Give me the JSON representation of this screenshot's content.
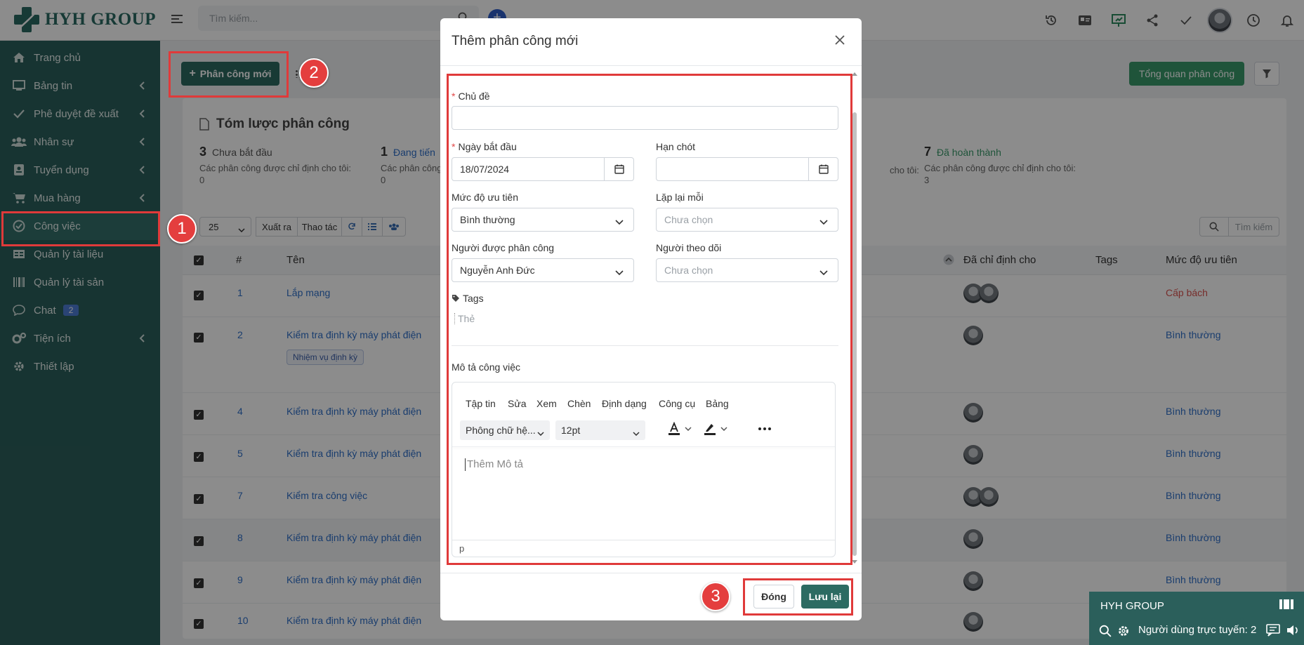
{
  "brand": {
    "name": "HYH GROUP"
  },
  "topbar": {
    "search_placeholder": "Tìm kiếm..."
  },
  "sidebar": {
    "items": [
      {
        "label": "Trang chủ"
      },
      {
        "label": "Bảng tin"
      },
      {
        "label": "Phê duyệt đề xuất"
      },
      {
        "label": "Nhân sự"
      },
      {
        "label": "Tuyển dụng"
      },
      {
        "label": "Mua hàng"
      },
      {
        "label": "Công việc"
      },
      {
        "label": "Quản lý tài liệu"
      },
      {
        "label": "Quản lý tài sản"
      },
      {
        "label": "Chat",
        "badge": "2"
      },
      {
        "label": "Tiện ích"
      },
      {
        "label": "Thiết lập"
      }
    ]
  },
  "main": {
    "new_button": "Phân công mới",
    "overview_button": "Tổng quan phân công",
    "summary_title": "Tóm lược phân công",
    "stats": [
      {
        "num": "3",
        "label": "Chưa bắt đầu",
        "sub": "Các phân công được chỉ định cho tôi:",
        "sub_value": "0"
      },
      {
        "num": "1",
        "label": "Đang tiến",
        "sub": "Các phân công",
        "sub_value": "0"
      },
      {
        "sub": "cho tôi:"
      },
      {
        "num": "7",
        "label": "Đã hoàn thành",
        "sub": "Các phân công được chỉ định cho tôi:",
        "sub_value": "3"
      }
    ],
    "toolbar": {
      "page_size": "25",
      "export": "Xuất ra",
      "action": "Thao tác",
      "search": "Tìm kiếm"
    },
    "table": {
      "headers": [
        "#",
        "Tên",
        "Đã chỉ định cho",
        "Tags",
        "Mức độ ưu tiên"
      ],
      "rows": [
        {
          "id": "1",
          "name": "Lắp mạng",
          "priority": "Cấp bách",
          "priority_color": "#d9534f"
        },
        {
          "id": "2",
          "name": "Kiểm tra định kỳ máy phát điện",
          "tag": "Nhiệm vụ định kỳ",
          "priority": "Bình thường",
          "priority_color": "#2f6fc9"
        },
        {
          "id": "4",
          "name": "Kiểm tra định kỳ máy phát điện",
          "priority": "Bình thường",
          "priority_color": "#2f6fc9"
        },
        {
          "id": "5",
          "name": "Kiểm tra định kỳ máy phát điện",
          "priority": "Bình thường",
          "priority_color": "#2f6fc9"
        },
        {
          "id": "7",
          "name": "Kiểm tra công việc",
          "priority": "Bình thường",
          "priority_color": "#2f6fc9"
        },
        {
          "id": "8",
          "name": "Kiểm tra định kỳ máy phát điện",
          "priority": "Bình thường",
          "priority_color": "#2f6fc9"
        },
        {
          "id": "9",
          "name": "Kiểm tra định kỳ máy phát điện",
          "priority": "Bình thường",
          "priority_color": "#2f6fc9"
        },
        {
          "id": "10",
          "name": "Kiểm tra định kỳ máy phát điện",
          "priority": "Bình thường",
          "priority_color": "#2f6fc9"
        }
      ]
    }
  },
  "modal": {
    "title": "Thêm phân công mới",
    "subject_label": "Chủ đề",
    "subject_value": "",
    "start_label": "Ngày bắt đầu",
    "start_value": "18/07/2024",
    "deadline_label": "Hạn chót",
    "deadline_value": "",
    "priority_label": "Mức độ ưu tiên",
    "priority_value": "Bình thường",
    "repeat_label": "Lặp lại mỗi",
    "repeat_value": "Chưa chọn",
    "assignee_label": "Người được phân công",
    "assignee_value": "Nguyễn Anh Đức",
    "follower_label": "Người theo dõi",
    "follower_value": "Chưa chọn",
    "tags_label": "Tags",
    "tags_placeholder": "Thẻ",
    "desc_label": "Mô tả công việc",
    "editor": {
      "menu": [
        "Tập tin",
        "Sửa",
        "Xem",
        "Chèn",
        "Định dạng",
        "Công cụ",
        "Bảng"
      ],
      "font": "Phông chữ hệ...",
      "size": "12pt",
      "placeholder": "Thêm Mô tả",
      "status": "p"
    },
    "close_button": "Đóng",
    "save_button": "Lưu lại"
  },
  "annotations": {
    "step1": "1",
    "step2": "2",
    "step3": "3"
  },
  "chat_widget": {
    "title": "HYH GROUP",
    "online": "Người dùng trực tuyến: 2"
  },
  "colors": {
    "brand": "#2b5f5b",
    "accent": "#2c6b62",
    "annotation": "#e03a3a",
    "required": "#e24747"
  }
}
